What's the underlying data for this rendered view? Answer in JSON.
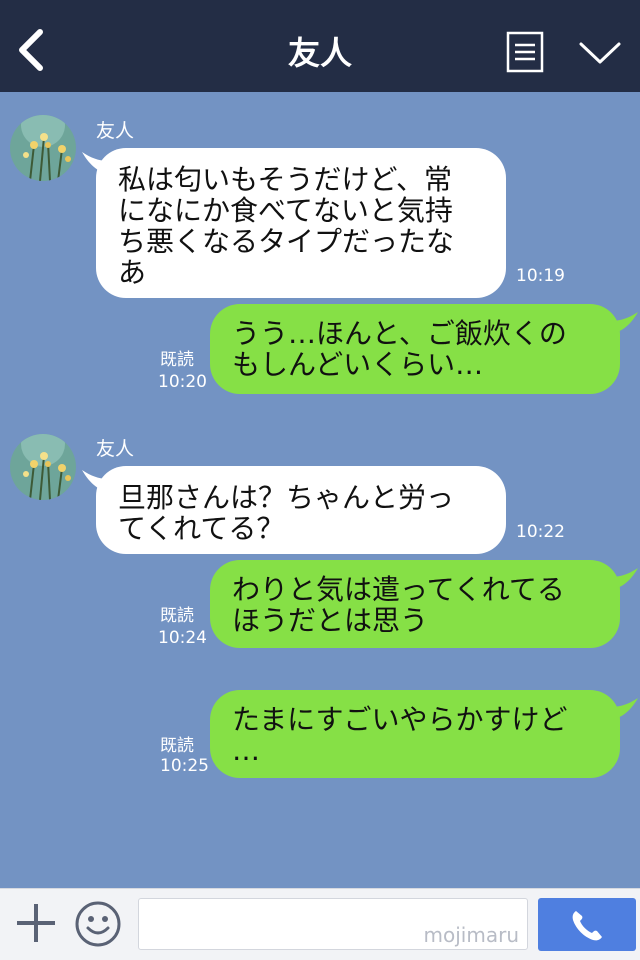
{
  "header": {
    "title": "友人"
  },
  "messages": [
    {
      "sender": "友人",
      "text": "私は匂いもそうだけど、常\nになにか食べてないと気持\nち悪くなるタイプだったな\nあ",
      "time": "10:19"
    },
    {
      "text": "うう…ほんと、ご飯炊くの\nもしんどいくらい…",
      "read": "既読",
      "time": "10:20"
    },
    {
      "sender": "友人",
      "text": "旦那さんは？ちゃんと労っ\nてくれてる？",
      "time": "10:22"
    },
    {
      "text": "わりと気は遣ってくれてる\nほうだとは思う",
      "read": "既読",
      "time": "10:24"
    },
    {
      "text": "たまにすごいやらかすけど\n…",
      "read": "既読",
      "time": "10:25"
    }
  ],
  "input": {
    "watermark": "mojimaru"
  },
  "colors": {
    "header": "#232d45",
    "background": "#7393c3",
    "outgoing": "#86e046",
    "incoming": "#ffffff",
    "call_button": "#4f7fe0"
  }
}
